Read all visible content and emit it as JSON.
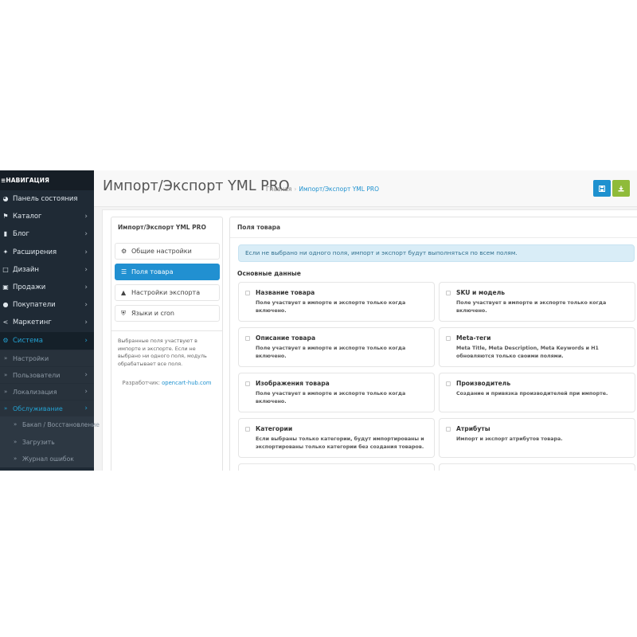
{
  "sidebar": {
    "nav_title": "НАВИГАЦИЯ",
    "items": [
      {
        "label": "Панель состояния",
        "icon": "dashboard-icon",
        "chevron": ""
      },
      {
        "label": "Каталог",
        "icon": "tags-icon",
        "chevron": "›"
      },
      {
        "label": "Блог",
        "icon": "book-icon",
        "chevron": "›"
      },
      {
        "label": "Расширения",
        "icon": "puzzle-icon",
        "chevron": "›"
      },
      {
        "label": "Дизайн",
        "icon": "monitor-icon",
        "chevron": "›"
      },
      {
        "label": "Продажи",
        "icon": "cart-icon",
        "chevron": "›"
      },
      {
        "label": "Покупатели",
        "icon": "user-icon",
        "chevron": "›"
      },
      {
        "label": "Маркетинг",
        "icon": "share-icon",
        "chevron": "›"
      },
      {
        "label": "Система",
        "icon": "gear-icon",
        "chevron": "›"
      }
    ],
    "system_sub": [
      {
        "label": "Настройки",
        "marker": "»",
        "chevron": ""
      },
      {
        "label": "Пользователи",
        "marker": "»",
        "chevron": "›"
      },
      {
        "label": "Локализация",
        "marker": "»",
        "chevron": "›"
      },
      {
        "label": "Обслуживание",
        "marker": "»",
        "chevron": "›"
      }
    ],
    "maintenance_sub": [
      {
        "label": "Бакап / Восстановление",
        "marker": "»"
      },
      {
        "label": "Загрузить",
        "marker": "»"
      },
      {
        "label": "Журнал ошибок",
        "marker": "»"
      }
    ]
  },
  "header": {
    "title": "Импорт/Экспорт YML PRO",
    "breadcrumb": {
      "home": "Главная",
      "separator": "›",
      "current": "Импорт/Экспорт YML PRO"
    },
    "save_icon": "floppy-icon",
    "download_icon": "download-icon"
  },
  "left_panel": {
    "title": "Импорт/Экспорт YML PRO",
    "tabs": [
      {
        "label": "Общие настройки",
        "icon": "cogs-icon"
      },
      {
        "label": "Поля товара",
        "icon": "list-icon"
      },
      {
        "label": "Настройки экспорта",
        "icon": "upload-icon"
      },
      {
        "label": "Языки и cron",
        "icon": "shield-icon"
      }
    ],
    "note": "Выбранные поля участвуют в импорте и экспорте. Если не выбрано ни одного поля, модуль обрабатывает все поля.",
    "developer_label": "Разработчик:",
    "developer_link": "opencart-hub.com"
  },
  "right_panel": {
    "title": "Поля товара",
    "alert": "Если не выбрано ни одного поля, импорт и экспорт будут выполняться по всем полям.",
    "section_title": "Основные данные",
    "fields": [
      {
        "title": "Название товара",
        "desc": "Поле участвует в импорте и экспорте только когда включено."
      },
      {
        "title": "SKU и модель",
        "desc": "Поле участвует в импорте и экспорте только когда включено."
      },
      {
        "title": "Описание товара",
        "desc": "Поле участвует в импорте и экспорте только когда включено."
      },
      {
        "title": "Meta-теги",
        "desc": "Meta Title, Meta Description, Meta Keywords и H1 обновляются только своими полями."
      },
      {
        "title": "Изображения товара",
        "desc": "Поле участвует в импорте и экспорте только когда включено."
      },
      {
        "title": "Производитель",
        "desc": "Создание и привязка производителей при импорте."
      },
      {
        "title": "Категории",
        "desc": "Если выбраны только категории, будут импортированы и экспортированы только категории без создания товаров."
      },
      {
        "title": "Атрибуты",
        "desc": "Импорт и экспорт атрибутов товара."
      }
    ]
  },
  "colors": {
    "sidebar": "#1f2a35",
    "accent": "#1e91cf",
    "active_tab": "#2190d1",
    "success": "#8fbb3a",
    "alert_bg": "#d9edf7"
  }
}
